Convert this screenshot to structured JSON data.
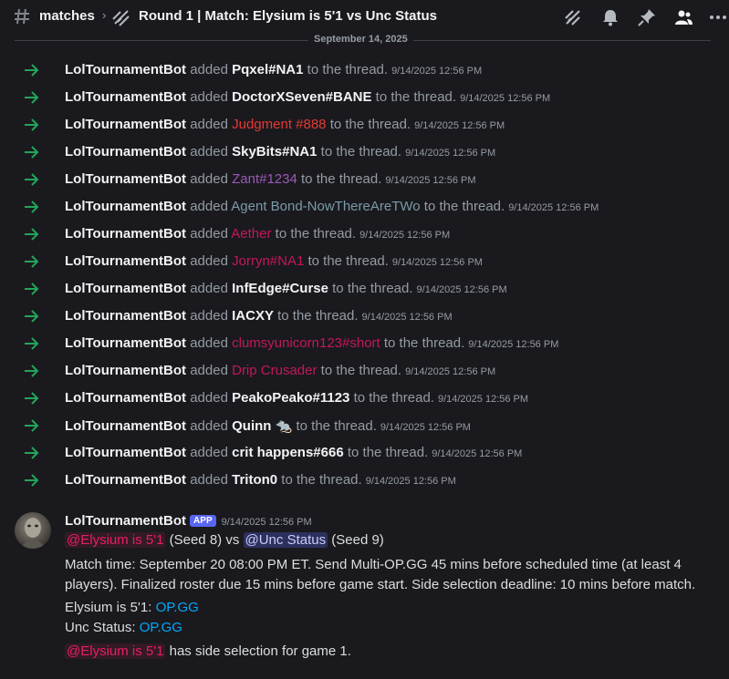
{
  "header": {
    "channel": "matches",
    "thread_title": "Round 1 | Match: Elysium is 5'1 vs Unc Status",
    "icons": [
      "threads-icon",
      "bell-icon",
      "pin-icon",
      "members-icon",
      "more-icon"
    ]
  },
  "date_divider": "September 14, 2025",
  "system_messages": [
    {
      "bot": "LolTournamentBot",
      "verb": "added",
      "target": "Pqxel#NA1",
      "color": "#f2f3f5",
      "bold": true,
      "tail": "to the thread.",
      "ts": "9/14/2025 12:56 PM"
    },
    {
      "bot": "LolTournamentBot",
      "verb": "added",
      "target": "DoctorXSeven#BANE",
      "color": "#f2f3f5",
      "bold": true,
      "tail": "to the thread.",
      "ts": "9/14/2025 12:56 PM"
    },
    {
      "bot": "LolTournamentBot",
      "verb": "added",
      "target": "Judgment #888",
      "color": "#e53935",
      "bold": false,
      "tail": "to the thread.",
      "ts": "9/14/2025 12:56 PM"
    },
    {
      "bot": "LolTournamentBot",
      "verb": "added",
      "target": "SkyBits#NA1",
      "color": "#f2f3f5",
      "bold": true,
      "tail": "to the thread.",
      "ts": "9/14/2025 12:56 PM"
    },
    {
      "bot": "LolTournamentBot",
      "verb": "added",
      "target": "Zant#1234",
      "color": "#9b59b6",
      "bold": false,
      "tail": "to the thread.",
      "ts": "9/14/2025 12:56 PM"
    },
    {
      "bot": "LolTournamentBot",
      "verb": "added",
      "target": "Agent Bond-NowThereAreTWo",
      "color": "#7a9aa8",
      "bold": false,
      "tail": "to the thread.",
      "ts": "9/14/2025 12:56 PM"
    },
    {
      "bot": "LolTournamentBot",
      "verb": "added",
      "target": "Aether",
      "color": "#c2185b",
      "bold": false,
      "tail": "to the thread.",
      "ts": "9/14/2025 12:56 PM"
    },
    {
      "bot": "LolTournamentBot",
      "verb": "added",
      "target": "Jorryn#NA1",
      "color": "#c2185b",
      "bold": false,
      "tail": "to the thread.",
      "ts": "9/14/2025 12:56 PM"
    },
    {
      "bot": "LolTournamentBot",
      "verb": "added",
      "target": "InfEdge#Curse",
      "color": "#f2f3f5",
      "bold": true,
      "tail": "to the thread.",
      "ts": "9/14/2025 12:56 PM"
    },
    {
      "bot": "LolTournamentBot",
      "verb": "added",
      "target": "IACXY",
      "color": "#f2f3f5",
      "bold": true,
      "tail": "to the thread.",
      "ts": "9/14/2025 12:56 PM"
    },
    {
      "bot": "LolTournamentBot",
      "verb": "added",
      "target": "clumsyunicorn123#short",
      "color": "#c2185b",
      "bold": false,
      "tail": "to the thread.",
      "ts": "9/14/2025 12:56 PM"
    },
    {
      "bot": "LolTournamentBot",
      "verb": "added",
      "target": "Drip Crusader",
      "color": "#c2185b",
      "bold": false,
      "tail": "to the thread.",
      "ts": "9/14/2025 12:56 PM"
    },
    {
      "bot": "LolTournamentBot",
      "verb": "added",
      "target": "PeakoPeako#1123",
      "color": "#f2f3f5",
      "bold": true,
      "tail": "to the thread.",
      "ts": "9/14/2025 12:56 PM"
    },
    {
      "bot": "LolTournamentBot",
      "verb": "added",
      "target": "Quinn",
      "color": "#f2f3f5",
      "bold": true,
      "tail": "to the thread.",
      "ts": "9/14/2025 12:56 PM",
      "emoji": "🐀"
    },
    {
      "bot": "LolTournamentBot",
      "verb": "added",
      "target": "crit happens#666",
      "color": "#f2f3f5",
      "bold": true,
      "tail": "to the thread.",
      "ts": "9/14/2025 12:56 PM"
    },
    {
      "bot": "LolTournamentBot",
      "verb": "added",
      "target": "Triton0",
      "color": "#f2f3f5",
      "bold": true,
      "tail": "to the thread.",
      "ts": "9/14/2025 12:56 PM"
    }
  ],
  "message": {
    "author": "LolTournamentBot",
    "badge": "APP",
    "timestamp": "9/14/2025 12:56 PM",
    "line1": {
      "mention1": "@Elysium is 5'1",
      "seed1": " (Seed 8) vs ",
      "mention2": "@Unc Status",
      "seed2": " (Seed 9)"
    },
    "line2": "Match time: September 20 08:00 PM ET. Send Multi-OP.GG 45 mins before scheduled time (at least 4",
    "line3": "players). Finalized roster due 15 mins before game start. Side selection deadline: 10 mins before match.",
    "line4_label": "Elysium is 5'1: ",
    "line4_link": "OP.GG",
    "line5_label": "Unc Status: ",
    "line5_link": "OP.GG",
    "line6_mention": "@Elysium is 5'1",
    "line6_text": " has side selection for game 1."
  }
}
